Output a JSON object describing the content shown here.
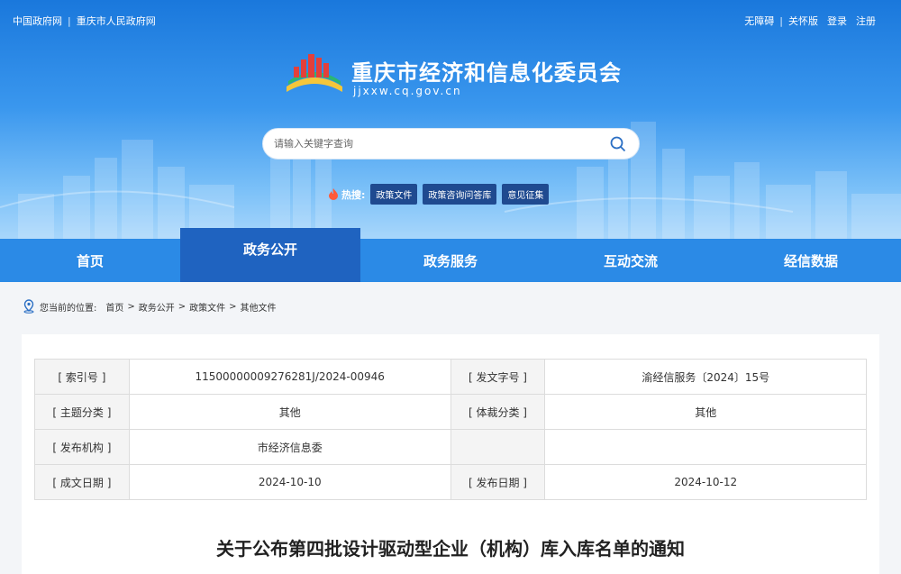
{
  "toplinks": {
    "left": [
      "中国政府网",
      "重庆市人民政府网"
    ],
    "right": [
      "无障碍",
      "关怀版",
      "登录",
      "注册"
    ]
  },
  "header": {
    "site_title": "重庆市经济和信息化委员会",
    "site_url": "jjxxw.cq.gov.cn"
  },
  "search": {
    "placeholder": "请输入关键字查询"
  },
  "hot": {
    "label": "热搜:",
    "tags": [
      "政策文件",
      "政策咨询问答库",
      "意见征集"
    ]
  },
  "nav": {
    "items": [
      "首页",
      "政务公开",
      "政务服务",
      "互动交流",
      "经信数据"
    ],
    "active_index": 1
  },
  "breadcrumb": {
    "prefix": "您当前的位置:",
    "items": [
      "首页",
      "政务公开",
      "政策文件",
      "其他文件"
    ],
    "sep": ">"
  },
  "meta": {
    "rows": [
      [
        {
          "k": "[ 索引号 ]",
          "v": "11500000009276281J/2024-00946"
        },
        {
          "k": "[ 发文字号 ]",
          "v": "渝经信服务〔2024〕15号"
        }
      ],
      [
        {
          "k": "[ 主题分类 ]",
          "v": "其他"
        },
        {
          "k": "[ 体裁分类 ]",
          "v": "其他"
        }
      ],
      [
        {
          "k": "[ 发布机构 ]",
          "v": "市经济信息委"
        },
        {
          "k": "",
          "v": ""
        }
      ],
      [
        {
          "k": "[ 成文日期 ]",
          "v": "2024-10-10"
        },
        {
          "k": "[ 发布日期 ]",
          "v": "2024-10-12"
        }
      ]
    ]
  },
  "document": {
    "title": "关于公布第四批设计驱动型企业（机构）库入库名单的通知"
  },
  "colors": {
    "nav_bg": "#2b8ae6",
    "nav_active": "#1f63c0",
    "hot_tag_bg": "#1f4a90"
  }
}
